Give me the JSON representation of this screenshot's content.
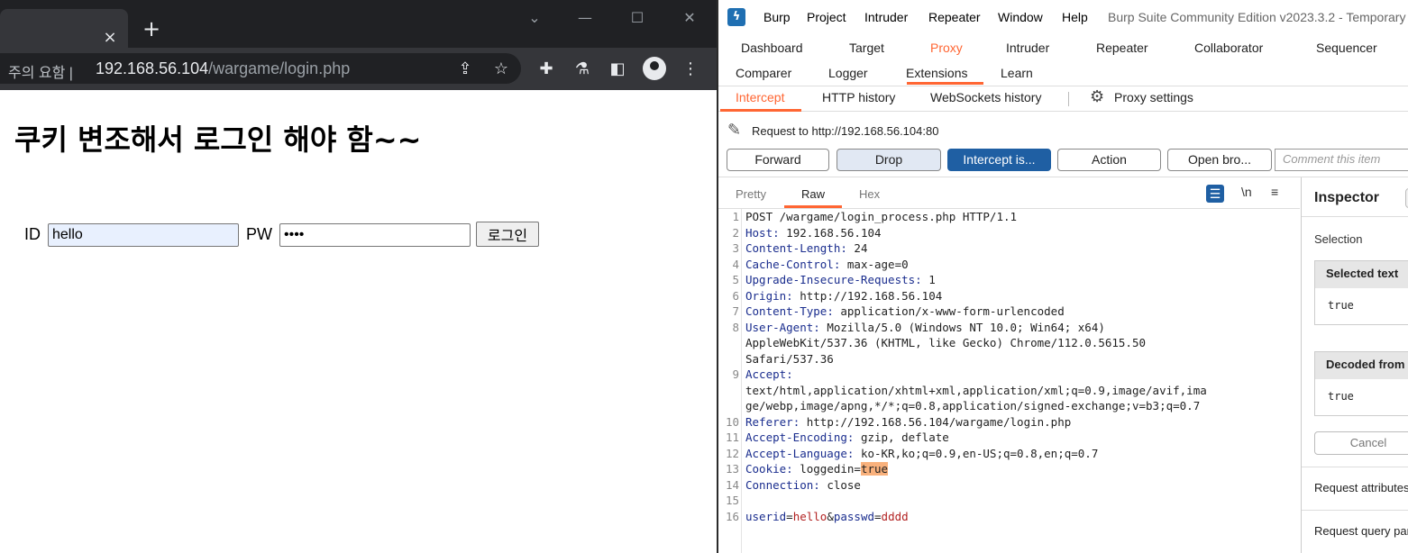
{
  "browser": {
    "tab_close": "×",
    "new_tab": "+",
    "win_dropdown": "⌄",
    "win_minimize": "—",
    "win_maximize": "☐",
    "win_close": "✕",
    "security_label": "주의 요함",
    "url_host": "192.168.56.104",
    "url_path": "/wargame/login.php",
    "icons": [
      "share-icon",
      "star-icon",
      "extensions-icon",
      "lab-icon",
      "sidepanel-icon",
      "profile-icon",
      "menu-icon"
    ]
  },
  "page": {
    "heading": "쿠키 변조해서 로그인 해야 함~~",
    "id_label": "ID",
    "id_value": "hello",
    "pw_label": "PW",
    "pw_value": "••••",
    "login_button": "로그인"
  },
  "burp": {
    "logo": "ϟ",
    "menu": [
      "Burp",
      "Project",
      "Intruder",
      "Repeater",
      "Window",
      "Help"
    ],
    "window_title": "Burp Suite Community Edition v2023.3.2 - Temporary",
    "main_tabs_row1": [
      "Dashboard",
      "Target",
      "Proxy",
      "Intruder",
      "Repeater",
      "Collaborator",
      "Sequencer"
    ],
    "main_tabs_row2": [
      "Comparer",
      "Logger",
      "Extensions",
      "Learn"
    ],
    "proxy_tabs": [
      "Intercept",
      "HTTP history",
      "WebSockets history"
    ],
    "proxy_settings": "Proxy settings",
    "request_to": "Request to http://192.168.56.104:80",
    "actions": {
      "forward": "Forward",
      "drop": "Drop",
      "intercept": "Intercept is...",
      "action": "Action",
      "open_browser": "Open bro...",
      "comment_placeholder": "Comment this item"
    },
    "editor_tabs": [
      "Pretty",
      "Raw",
      "Hex"
    ],
    "editor_icons": [
      "wrap-icon",
      "\\n",
      "≡"
    ],
    "request_lines": [
      {
        "n": "1",
        "text": "POST /wargame/login_process.php HTTP/1.1"
      },
      {
        "n": "2",
        "name": "Host",
        "value": " 192.168.56.104"
      },
      {
        "n": "3",
        "name": "Content-Length",
        "value": " 24"
      },
      {
        "n": "4",
        "name": "Cache-Control",
        "value": " max-age=0"
      },
      {
        "n": "5",
        "name": "Upgrade-Insecure-Requests",
        "value": " 1"
      },
      {
        "n": "6",
        "name": "Origin",
        "value": " http://192.168.56.104"
      },
      {
        "n": "7",
        "name": "Content-Type",
        "value": " application/x-www-form-urlencoded"
      },
      {
        "n": "8",
        "name": "User-Agent",
        "value": " Mozilla/5.0 (Windows NT 10.0; Win64; x64)"
      },
      {
        "n": "",
        "text": "AppleWebKit/537.36 (KHTML, like Gecko) Chrome/112.0.5615.50"
      },
      {
        "n": "",
        "text": "Safari/537.36"
      },
      {
        "n": "9",
        "name": "Accept",
        "value": ""
      },
      {
        "n": "",
        "text": "text/html,application/xhtml+xml,application/xml;q=0.9,image/avif,ima"
      },
      {
        "n": "",
        "text": "ge/webp,image/apng,*/*;q=0.8,application/signed-exchange;v=b3;q=0.7"
      },
      {
        "n": "10",
        "name": "Referer",
        "value": " http://192.168.56.104/wargame/login.php"
      },
      {
        "n": "11",
        "name": "Accept-Encoding",
        "value": " gzip, deflate"
      },
      {
        "n": "12",
        "name": "Accept-Language",
        "value": " ko-KR,ko;q=0.9,en-US;q=0.8,en;q=0.7"
      },
      {
        "n": "13",
        "name": "Cookie",
        "value": " loggedin=",
        "highlight": "true"
      },
      {
        "n": "14",
        "name": "Connection",
        "value": " close"
      },
      {
        "n": "15",
        "text": ""
      },
      {
        "n": "16",
        "body": [
          {
            "k": "userid",
            "v": "hello"
          },
          {
            "k": "passwd",
            "v": "dddd"
          }
        ]
      }
    ],
    "inspector": {
      "title": "Inspector",
      "selection": "Selection",
      "selected_text_label": "Selected text",
      "selected_text_value": "true",
      "decoded_label": "Decoded from",
      "decoded_value": "true",
      "cancel": "Cancel",
      "request_attributes": "Request attributes",
      "request_query": "Request query para"
    },
    "colors": {
      "accent": "#ff6633",
      "primary_button": "#1f5fa3",
      "header_name": "#1a2d8e",
      "param_value": "#b22222",
      "highlight": "#f9b17c"
    }
  }
}
